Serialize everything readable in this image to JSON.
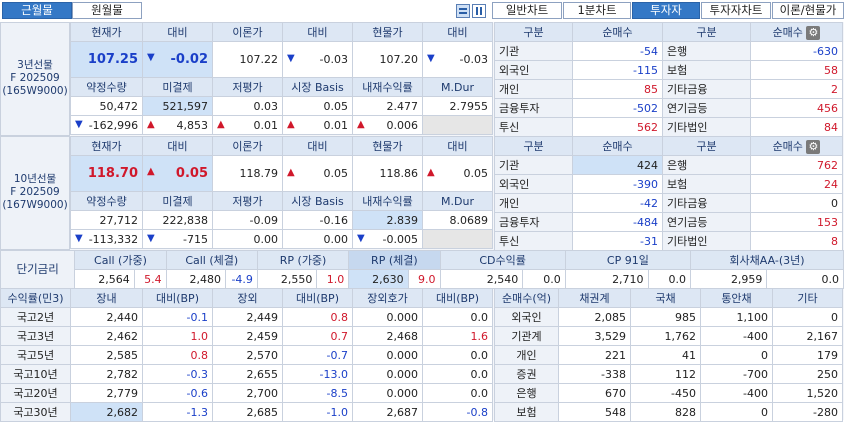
{
  "tabs": {
    "active": "근월물",
    "inactive": "원월물"
  },
  "chart_buttons": [
    "일반차트",
    "1분차트",
    "투자자",
    "투자자차트",
    "이론/현물가"
  ],
  "active_chart_button": "투자자",
  "fut3": {
    "side_label": [
      "3년선물",
      "F 202509",
      "(165W9000)"
    ],
    "headers1": [
      "현재가",
      "대비",
      "이론가",
      "대비",
      "현물가",
      "대비"
    ],
    "row1": {
      "current": "107.25",
      "chg": "-0.02",
      "theory": "107.22",
      "theory_chg": "-0.03",
      "spot": "107.20",
      "spot_chg": "-0.03"
    },
    "headers2": [
      "약정수량",
      "미결제",
      "저평가",
      "시장 Basis",
      "내재수익률",
      "M.Dur"
    ],
    "row2": [
      "50,472",
      "521,597",
      "0.03",
      "0.05",
      "2.477",
      "2.7955"
    ],
    "row3": [
      "-162,996",
      "4,853",
      "0.01",
      "0.01",
      "0.006",
      ""
    ],
    "inv_headers": [
      "구분",
      "순매수",
      "구분",
      "순매수"
    ],
    "investors": [
      [
        "기관",
        "-54",
        "은행",
        "-630"
      ],
      [
        "외국인",
        "-115",
        "보험",
        "58"
      ],
      [
        "개인",
        "85",
        "기타금융",
        "2"
      ],
      [
        "금융투자",
        "-502",
        "연기금등",
        "456"
      ],
      [
        "투신",
        "562",
        "기타법인",
        "84"
      ]
    ]
  },
  "fut10": {
    "side_label": [
      "10년선물",
      "F 202509",
      "(167W9000)"
    ],
    "headers1": [
      "현재가",
      "대비",
      "이론가",
      "대비",
      "현물가",
      "대비"
    ],
    "row1": {
      "current": "118.70",
      "chg": "0.05",
      "theory": "118.79",
      "theory_chg": "0.05",
      "spot": "118.86",
      "spot_chg": "0.05"
    },
    "headers2": [
      "약정수량",
      "미결제",
      "저평가",
      "시장 Basis",
      "내재수익률",
      "M.Dur"
    ],
    "row2": [
      "27,712",
      "222,838",
      "-0.09",
      "-0.16",
      "2.839",
      "8.0689"
    ],
    "row3": [
      "-113,332",
      "-715",
      "0.00",
      "0.00",
      "-0.005",
      ""
    ],
    "inv_headers": [
      "구분",
      "순매수",
      "구분",
      "순매수"
    ],
    "investors": [
      [
        "기관",
        "424",
        "은행",
        "762"
      ],
      [
        "외국인",
        "-390",
        "보험",
        "24"
      ],
      [
        "개인",
        "-42",
        "기타금융",
        "0"
      ],
      [
        "금융투자",
        "-484",
        "연기금등",
        "153"
      ],
      [
        "투신",
        "-31",
        "기타법인",
        "8"
      ]
    ]
  },
  "short_rate": {
    "label": "단기금리",
    "headers": [
      "Call (가중)",
      "Call (체결)",
      "RP (가중)",
      "RP (체결)",
      "CD수익률",
      "CP 91일",
      "회사채AA-(3년)"
    ],
    "values": [
      [
        "2,564",
        "5.4"
      ],
      [
        "2,480",
        "-4.9"
      ],
      [
        "2,550",
        "1.0"
      ],
      [
        "2,630",
        "9.0"
      ],
      [
        "2,540",
        "0.0"
      ],
      [
        "2,710",
        "0.0"
      ],
      [
        "2,959",
        "0.0"
      ]
    ]
  },
  "yield_table": {
    "headers": [
      "수익률(민3)",
      "장내",
      "대비(BP)",
      "장외",
      "대비(BP)",
      "장외호가",
      "대비(BP)"
    ],
    "rows": [
      [
        "국고2년",
        "2,440",
        "-0.1",
        "2,449",
        "0.8",
        "0.000",
        "0.0"
      ],
      [
        "국고3년",
        "2,462",
        "1.0",
        "2,459",
        "0.7",
        "2,468",
        "1.6"
      ],
      [
        "국고5년",
        "2,585",
        "0.8",
        "2,570",
        "-0.7",
        "0.000",
        "0.0"
      ],
      [
        "국고10년",
        "2,782",
        "-0.3",
        "2,655",
        "-13.0",
        "0.000",
        "0.0"
      ],
      [
        "국고20년",
        "2,779",
        "-0.6",
        "2,700",
        "-8.5",
        "0.000",
        "0.0"
      ],
      [
        "국고30년",
        "2,682",
        "-1.3",
        "2,685",
        "-1.0",
        "2,687",
        "-0.8"
      ]
    ]
  },
  "net_buy_table": {
    "headers": [
      "순매수(억)",
      "채권계",
      "국채",
      "통안채",
      "기타"
    ],
    "rows": [
      [
        "외국인",
        "2,085",
        "985",
        "1,100",
        "0"
      ],
      [
        "기관계",
        "3,529",
        "1,762",
        "-400",
        "2,167"
      ],
      [
        "개인",
        "221",
        "41",
        "0",
        "179"
      ],
      [
        "증권",
        "-338",
        "112",
        "-700",
        "250"
      ],
      [
        "은행",
        "670",
        "-450",
        "-400",
        "1,520"
      ],
      [
        "보험",
        "548",
        "828",
        "0",
        "-280"
      ]
    ]
  },
  "colors": {
    "accent": "#3478c6",
    "up": "#d0182b",
    "down": "#1a3fc8",
    "header_bg": "#dde7f4"
  },
  "icons": [
    "layout-icon-1",
    "layout-icon-2",
    "settings-gear-icon"
  ]
}
